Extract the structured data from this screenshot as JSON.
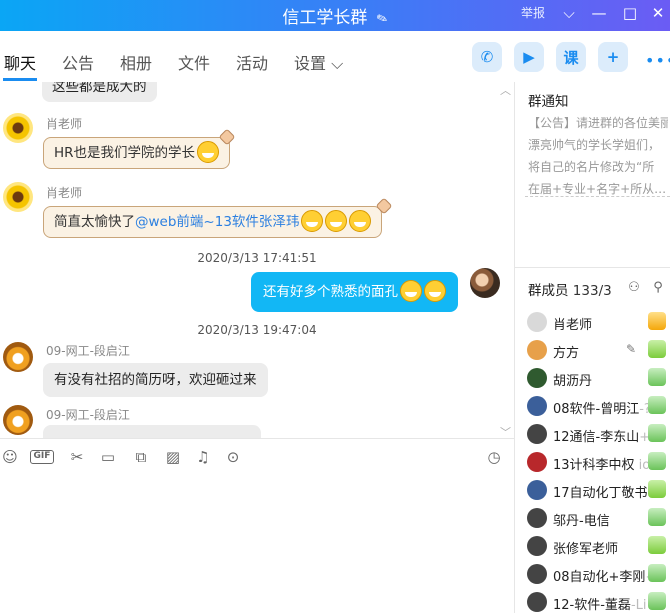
{
  "window": {
    "title": "信工学长群",
    "edit_icon": "pencil-icon",
    "report": "举报",
    "controls": [
      "chevron-down-icon",
      "minimize-icon",
      "maximize-icon",
      "close-icon"
    ]
  },
  "tabs": [
    {
      "label": "聊天",
      "active": true
    },
    {
      "label": "公告"
    },
    {
      "label": "相册"
    },
    {
      "label": "文件"
    },
    {
      "label": "活动"
    },
    {
      "label": "设置 ⌵"
    }
  ],
  "toolbar": {
    "icons": [
      "phone-icon",
      "video-icon",
      "class-icon",
      "add-app-icon",
      "more-icon"
    ],
    "class_label": "课",
    "more_label": "•••"
  },
  "chat": {
    "top_partial_message": "这些都是成大的",
    "messages": [
      {
        "sender": "肖老师",
        "text": "HR也是我们学院的学长",
        "style": "paper",
        "emoji_count": 1
      },
      {
        "sender": "肖老师",
        "text": "简直太愉快了",
        "mention": "@web前端~13软件张泽玮",
        "style": "paper",
        "emoji_count": 3
      },
      {
        "timestamp": "2020/3/13 17:41:51"
      },
      {
        "sender": "",
        "text": "还有好多个熟悉的面孔",
        "style": "blue",
        "self": true,
        "emoji_count": 2
      },
      {
        "timestamp": "2020/3/13 19:47:04"
      },
      {
        "sender": "09-网工-段启江",
        "text": "有没有社招的简历呀，欢迎砸过来",
        "style": "gray"
      },
      {
        "sender": "09-网工-段启江",
        "text": "",
        "style": "gray"
      }
    ],
    "timestamps": [
      "2020/3/13 17:41:51",
      "2020/3/13 19:47:04"
    ]
  },
  "input_toolbar": {
    "icons": [
      "emoji-icon",
      "gif-icon",
      "scissors-icon",
      "folder-icon",
      "screenshot-icon",
      "image-icon",
      "bell-icon",
      "more-circle-icon",
      "history-clock-icon"
    ],
    "gif_label": "GIF"
  },
  "sidebar": {
    "notice_title": "群通知",
    "notice_lines": [
      "【公告】请进群的各位美丽",
      "漂亮帅气的学长学姐们，",
      "将自己的名片修改为“所",
      "在届+专业+名字+所从…"
    ],
    "members_title": "群成员",
    "members_count": "133/3",
    "members_count_fade": "3",
    "members": [
      {
        "name": "肖老师",
        "badge": "owner"
      },
      {
        "name": "方方",
        "badge": "admin",
        "edit": true
      },
      {
        "name": "胡沥丹",
        "badge": "user"
      },
      {
        "name": "08软件-曾明江",
        "suffix": "-?",
        "badge": "user"
      },
      {
        "name": "12通信-李东山",
        "suffix": "+",
        "badge": "user"
      },
      {
        "name": "13计科李中权",
        "suffix": " io",
        "badge": "user"
      },
      {
        "name": "17自动化丁敬书",
        "badge": "admin"
      },
      {
        "name": "邬丹-电信",
        "badge": "user"
      },
      {
        "name": "张修军老师",
        "badge": "admin"
      },
      {
        "name": "08自动化+李刚",
        "suffix": "+",
        "badge": "user"
      },
      {
        "name": "12-软件-董磊",
        "suffix": "-Li",
        "badge": "user"
      }
    ]
  }
}
